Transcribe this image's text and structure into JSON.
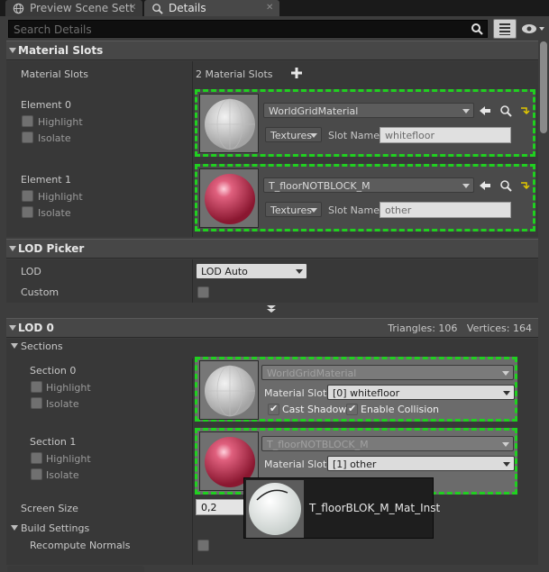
{
  "tabs": [
    {
      "label": "Preview Scene Sett",
      "active": false,
      "icon": "globe-icon"
    },
    {
      "label": "Details",
      "active": true,
      "icon": "details-icon"
    }
  ],
  "search": {
    "placeholder": "Search Details"
  },
  "material_slots": {
    "header": "Material Slots",
    "row_label": "Material Slots",
    "count_text": "2 Material Slots",
    "elements": [
      {
        "label": "Element 0",
        "highlight": "Highlight",
        "isolate": "Isolate",
        "material": "WorldGridMaterial",
        "textures": "Textures",
        "slot_name_label": "Slot Name",
        "slot_name": "whitefloor"
      },
      {
        "label": "Element 1",
        "highlight": "Highlight",
        "isolate": "Isolate",
        "material": "T_floorNOTBLOCK_M",
        "textures": "Textures",
        "slot_name_label": "Slot Name",
        "slot_name": "other"
      }
    ]
  },
  "lod_picker": {
    "header": "LOD Picker",
    "lod_label": "LOD",
    "lod_value": "LOD Auto",
    "custom_label": "Custom"
  },
  "lod0": {
    "header": "LOD 0",
    "stats": "Triangles: 106   Vertices: 164",
    "sections_label": "Sections",
    "sections": [
      {
        "label": "Section 0",
        "highlight": "Highlight",
        "isolate": "Isolate",
        "material": "WorldGridMaterial",
        "material_slot_label": "Material Slot",
        "material_slot": "[0] whitefloor",
        "cast_shadow": "Cast Shadow",
        "enable_collision": "Enable Collision"
      },
      {
        "label": "Section 1",
        "highlight": "Highlight",
        "isolate": "Isolate",
        "material": "T_floorNOTBLOCK_M",
        "material_slot_label": "Material Slot",
        "material_slot": "[1] other"
      }
    ],
    "screen_size_label": "Screen Size",
    "screen_size": "0,2",
    "build_settings_label": "Build Settings",
    "recompute_normals_label": "Recompute Normals"
  },
  "tooltip": {
    "text": "T_floorBLOK_M_Mat_Inst"
  },
  "colors": {
    "accent_dashed": "#20d020",
    "panel": "#3d3d3d",
    "header": "#474747"
  }
}
